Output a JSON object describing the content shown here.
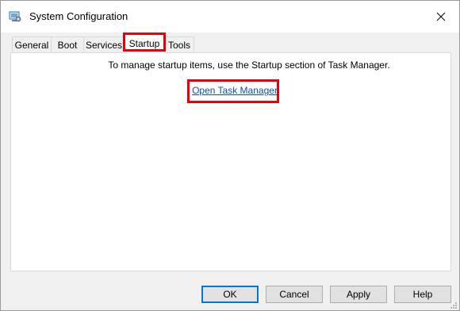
{
  "window": {
    "title": "System Configuration"
  },
  "icons": {
    "app": "system-configuration-icon",
    "close": "close-icon",
    "resize": "resize-grip-icon"
  },
  "tabs": [
    {
      "label": "General"
    },
    {
      "label": "Boot"
    },
    {
      "label": "Services"
    },
    {
      "label": "Startup",
      "selected": true
    },
    {
      "label": "Tools"
    }
  ],
  "startup": {
    "message": "To manage startup items, use the Startup section of Task Manager.",
    "link_label": "Open Task Manager"
  },
  "buttons": {
    "ok": "OK",
    "cancel": "Cancel",
    "apply": "Apply",
    "help": "Help"
  },
  "colors": {
    "highlight": "#e8000b",
    "link": "#0f4fa8",
    "default_button_border": "#0078d7"
  }
}
